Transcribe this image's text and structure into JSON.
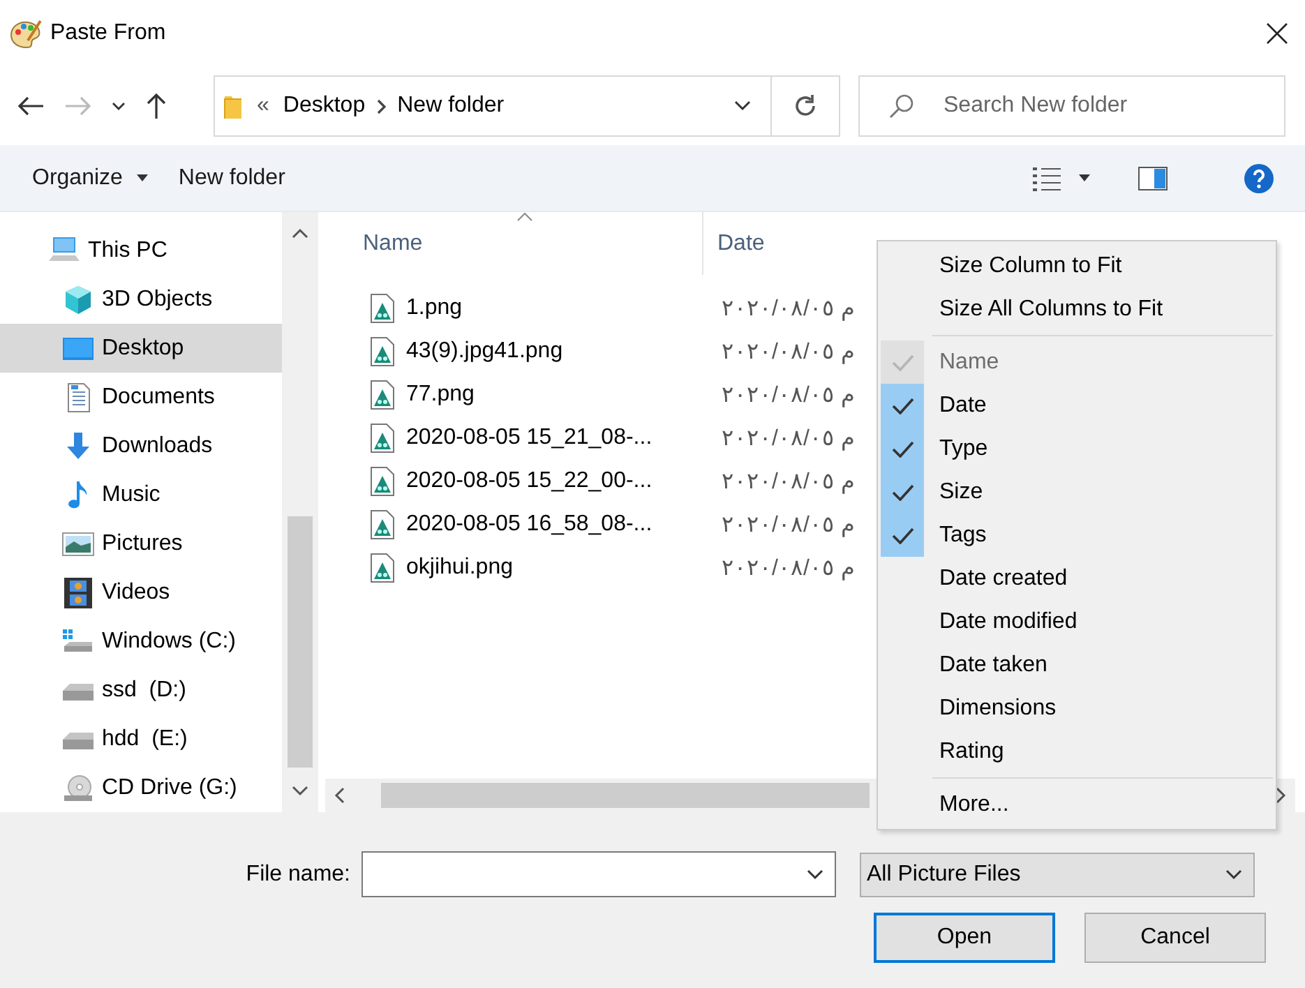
{
  "window": {
    "title": "Paste From"
  },
  "address": {
    "overflow": "«",
    "path": [
      {
        "label": "Desktop"
      },
      {
        "label": "New folder"
      }
    ]
  },
  "search": {
    "placeholder": "Search New folder"
  },
  "toolbar": {
    "organize": "Organize",
    "new_folder": "New folder"
  },
  "sidebar": {
    "items": [
      {
        "label": "This PC",
        "kind": "pc",
        "selected": false,
        "children": [
          {
            "label": "3D Objects",
            "kind": "objects",
            "selected": false
          },
          {
            "label": "Desktop",
            "kind": "desktop",
            "selected": true
          },
          {
            "label": "Documents",
            "kind": "documents",
            "selected": false
          },
          {
            "label": "Downloads",
            "kind": "downloads",
            "selected": false
          },
          {
            "label": "Music",
            "kind": "music",
            "selected": false
          },
          {
            "label": "Pictures",
            "kind": "pictures",
            "selected": false
          },
          {
            "label": "Videos",
            "kind": "videos",
            "selected": false
          },
          {
            "label": "Windows (C:)",
            "kind": "system-drive",
            "selected": false
          },
          {
            "label": "ssd  (D:)",
            "kind": "drive",
            "selected": false
          },
          {
            "label": "hdd  (E:)",
            "kind": "drive",
            "selected": false
          },
          {
            "label": "CD Drive (G:)",
            "kind": "disc",
            "selected": false
          }
        ]
      }
    ]
  },
  "file_list": {
    "columns": [
      {
        "label": "Name",
        "sorted": true
      },
      {
        "label": "Date",
        "sorted": false
      }
    ],
    "rows": [
      {
        "name": "1.png",
        "date": "٢٠٢٠/٠٨/٠٥ م"
      },
      {
        "name": "43(9).jpg41.png",
        "date": "٢٠٢٠/٠٨/٠٥ م"
      },
      {
        "name": "77.png",
        "date": "٢٠٢٠/٠٨/٠٥ م"
      },
      {
        "name": "2020-08-05 15_21_08-...",
        "date": "٢٠٢٠/٠٨/٠٥ م"
      },
      {
        "name": "2020-08-05 15_22_00-...",
        "date": "٢٠٢٠/٠٨/٠٥ م"
      },
      {
        "name": "2020-08-05 16_58_08-...",
        "date": "٢٠٢٠/٠٨/٠٥ م"
      },
      {
        "name": "okjihui.png",
        "date": "٢٠٢٠/٠٨/٠٥ م"
      }
    ]
  },
  "context_menu": {
    "items": [
      {
        "kind": "action",
        "label": "Size Column to Fit"
      },
      {
        "kind": "action",
        "label": "Size All Columns to Fit"
      },
      {
        "kind": "separator"
      },
      {
        "kind": "check",
        "label": "Name",
        "checked": true,
        "disabled": true
      },
      {
        "kind": "check",
        "label": "Date",
        "checked": true,
        "disabled": false
      },
      {
        "kind": "check",
        "label": "Type",
        "checked": true,
        "disabled": false
      },
      {
        "kind": "check",
        "label": "Size",
        "checked": true,
        "disabled": false
      },
      {
        "kind": "check",
        "label": "Tags",
        "checked": true,
        "disabled": false
      },
      {
        "kind": "check",
        "label": "Date created",
        "checked": false,
        "disabled": false
      },
      {
        "kind": "check",
        "label": "Date modified",
        "checked": false,
        "disabled": false
      },
      {
        "kind": "check",
        "label": "Date taken",
        "checked": false,
        "disabled": false
      },
      {
        "kind": "check",
        "label": "Dimensions",
        "checked": false,
        "disabled": false
      },
      {
        "kind": "check",
        "label": "Rating",
        "checked": false,
        "disabled": false
      },
      {
        "kind": "separator"
      },
      {
        "kind": "action",
        "label": "More..."
      }
    ]
  },
  "footer": {
    "file_name_label": "File name:",
    "file_type": "All Picture Files",
    "buttons": [
      {
        "label": "Open",
        "default": true
      },
      {
        "label": "Cancel",
        "default": false
      }
    ]
  }
}
